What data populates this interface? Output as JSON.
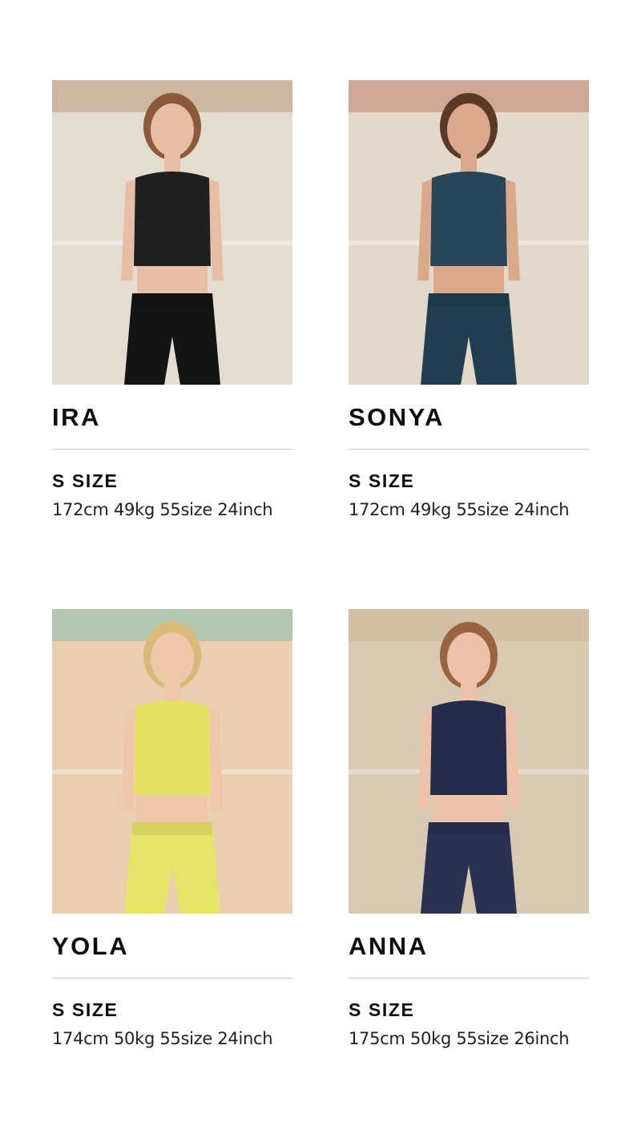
{
  "models": [
    {
      "name": "IRA",
      "size_label": "S SIZE",
      "measurements": "172cm 49kg 55size 24inch",
      "colors": {
        "bg": "#e4ddcf",
        "top": "#1f1f21",
        "bottom": "#141416",
        "skin": "#e7bea4",
        "hair": "#8a5a3a",
        "accent": "#a0744a"
      }
    },
    {
      "name": "SONYA",
      "size_label": "S SIZE",
      "measurements": "172cm 49kg 55size 24inch",
      "colors": {
        "bg": "#e2d9ca",
        "top": "#294558",
        "bottom": "#233e50",
        "skin": "#d9a98a",
        "hair": "#5a3a26",
        "accent": "#b04a3a"
      }
    },
    {
      "name": "YOLA",
      "size_label": "S SIZE",
      "measurements": "174cm 50kg 55size 24inch",
      "colors": {
        "bg": "#e9cfb0",
        "top": "#e4e262",
        "bottom": "#e6e56a",
        "skin": "#f0c6aa",
        "hair": "#d9b978",
        "accent": "#4fb8ad"
      }
    },
    {
      "name": "ANNA",
      "size_label": "S SIZE",
      "measurements": "175cm 50kg 55size 26inch",
      "colors": {
        "bg": "#d8cab2",
        "top": "#252c4a",
        "bottom": "#2a3254",
        "skin": "#edc2a8",
        "hair": "#9a6440",
        "accent": "#c9b08a"
      }
    }
  ]
}
